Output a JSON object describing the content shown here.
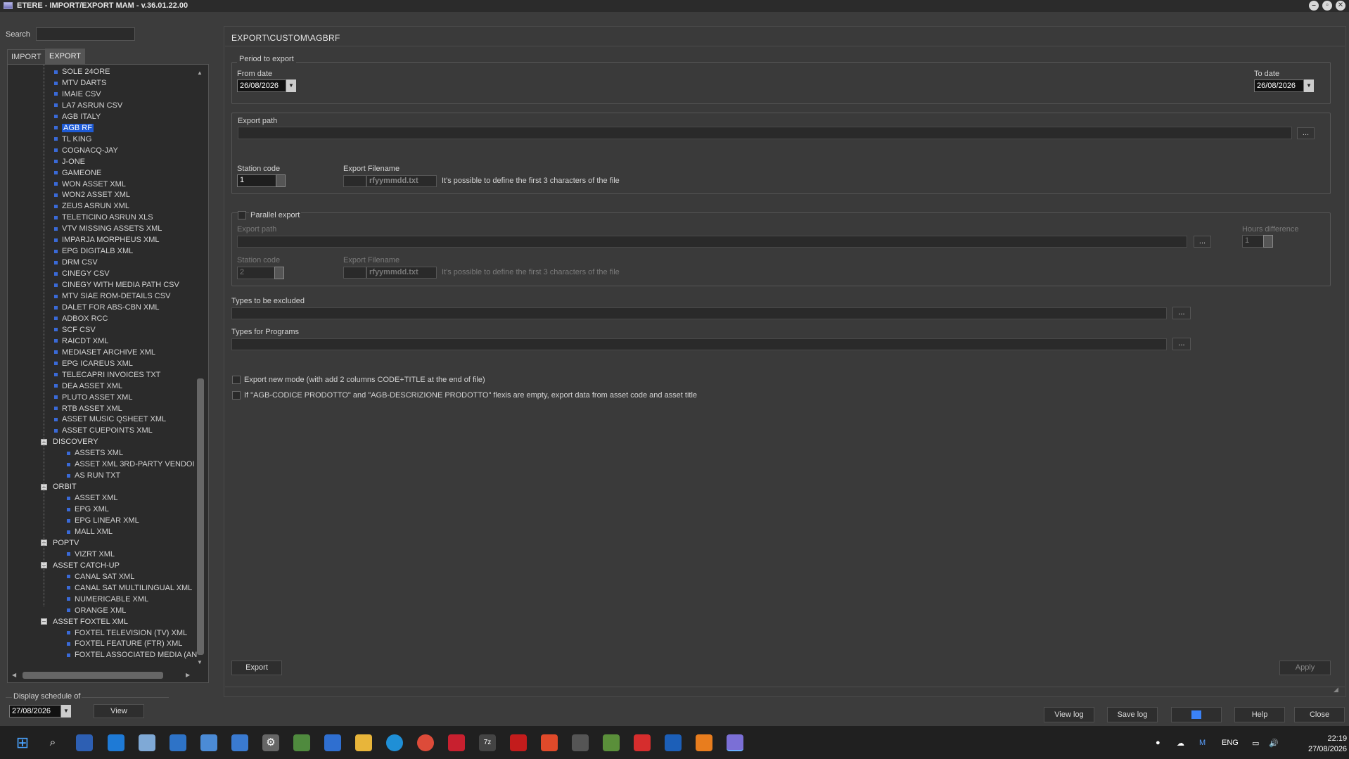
{
  "window": {
    "title": "ETERE - IMPORT/EXPORT MAM - v.36.01.22.00"
  },
  "left": {
    "search_label": "Search",
    "search_value": "",
    "tabs": [
      "IMPORT",
      "EXPORT"
    ],
    "tree_items": [
      {
        "label": "SOLE 24ORE",
        "indent": 1
      },
      {
        "label": "MTV DARTS",
        "indent": 1
      },
      {
        "label": "IMAIE CSV",
        "indent": 1
      },
      {
        "label": "LA7 ASRUN CSV",
        "indent": 1
      },
      {
        "label": "AGB ITALY",
        "indent": 1
      },
      {
        "label": "AGB RF",
        "indent": 1,
        "selected": true
      },
      {
        "label": "TL KING",
        "indent": 1
      },
      {
        "label": "COGNACQ-JAY",
        "indent": 1
      },
      {
        "label": "J-ONE",
        "indent": 1
      },
      {
        "label": "GAMEONE",
        "indent": 1
      },
      {
        "label": "WON ASSET XML",
        "indent": 1
      },
      {
        "label": "WON2 ASSET XML",
        "indent": 1
      },
      {
        "label": "ZEUS ASRUN XML",
        "indent": 1
      },
      {
        "label": "TELETICINO ASRUN XLS",
        "indent": 1
      },
      {
        "label": "VTV MISSING ASSETS XML",
        "indent": 1
      },
      {
        "label": "IMPARJA MORPHEUS XML",
        "indent": 1
      },
      {
        "label": "EPG DIGITALB XML",
        "indent": 1
      },
      {
        "label": "DRM CSV",
        "indent": 1
      },
      {
        "label": "CINEGY CSV",
        "indent": 1
      },
      {
        "label": "CINEGY WITH MEDIA PATH CSV",
        "indent": 1
      },
      {
        "label": "MTV SIAE ROM-DETAILS CSV",
        "indent": 1
      },
      {
        "label": "DALET FOR ABS-CBN XML",
        "indent": 1
      },
      {
        "label": "ADBOX RCC",
        "indent": 1
      },
      {
        "label": "SCF CSV",
        "indent": 1
      },
      {
        "label": "RAICDT XML",
        "indent": 1
      },
      {
        "label": "MEDIASET ARCHIVE XML",
        "indent": 1
      },
      {
        "label": "EPG ICAREUS XML",
        "indent": 1
      },
      {
        "label": "TELECAPRI INVOICES TXT",
        "indent": 1
      },
      {
        "label": "DEA ASSET XML",
        "indent": 1
      },
      {
        "label": "PLUTO ASSET XML",
        "indent": 1
      },
      {
        "label": "RTB ASSET XML",
        "indent": 1
      },
      {
        "label": "ASSET MUSIC QSHEET XML",
        "indent": 1
      },
      {
        "label": "ASSET CUEPOINTS XML",
        "indent": 1
      },
      {
        "label": "DISCOVERY",
        "group": true
      },
      {
        "label": "ASSETS XML",
        "indent": 2
      },
      {
        "label": "ASSET XML 3RD-PARTY VENDOI",
        "indent": 2
      },
      {
        "label": "AS RUN TXT",
        "indent": 2
      },
      {
        "label": "ORBIT",
        "group": true
      },
      {
        "label": "ASSET XML",
        "indent": 2
      },
      {
        "label": "EPG XML",
        "indent": 2
      },
      {
        "label": "EPG LINEAR XML",
        "indent": 2
      },
      {
        "label": "MALL XML",
        "indent": 2
      },
      {
        "label": "POPTV",
        "group": true
      },
      {
        "label": "VIZRT XML",
        "indent": 2
      },
      {
        "label": "ASSET CATCH-UP",
        "group": true
      },
      {
        "label": "CANAL SAT XML",
        "indent": 2
      },
      {
        "label": "CANAL SAT MULTILINGUAL XML",
        "indent": 2
      },
      {
        "label": "NUMERICABLE XML",
        "indent": 2
      },
      {
        "label": "ORANGE XML",
        "indent": 2
      },
      {
        "label": "ASSET FOXTEL XML",
        "group": true
      },
      {
        "label": "FOXTEL TELEVISION (TV) XML",
        "indent": 2
      },
      {
        "label": "FOXTEL FEATURE (FTR) XML",
        "indent": 2
      },
      {
        "label": "FOXTEL ASSOCIATED MEDIA (AN",
        "indent": 2
      }
    ],
    "display_schedule_label": "Display schedule of",
    "display_date": "27/08/2026",
    "view_button": "View"
  },
  "main": {
    "path_title": "EXPORT\\CUSTOM\\AGBRF",
    "period": {
      "group_label": "Period to export",
      "from_label": "From date",
      "from_value": "26/08/2026",
      "to_label": "To date",
      "to_value": "26/08/2026"
    },
    "export": {
      "path_label": "Export path",
      "path_value": "",
      "browse": "...",
      "station_label": "Station code",
      "station_value": "1",
      "filename_label": "Export Filename",
      "filename_value": "rfyymmdd.txt",
      "filename_hint": "It's possible to define the first 3 characters of the file"
    },
    "parallel": {
      "checkbox_label": "Parallel export",
      "path_label": "Export path",
      "browse": "...",
      "hours_label": "Hours difference",
      "hours_value": "1",
      "station_label": "Station code",
      "station_value": "2",
      "filename_label": "Export Filename",
      "filename_value": "rfyymmdd.txt",
      "filename_hint": "It's possible to define the first 3 characters of the file"
    },
    "types_excluded_label": "Types to be excluded",
    "types_programs_label": "Types for Programs",
    "browse": "...",
    "option1": "Export new mode (with add 2 columns CODE+TITLE at the end of file)",
    "option2": "If \"AGB-CODICE PRODOTTO\" and \"AGB-DESCRIZIONE PRODOTTO\" flexis are empty, export data from asset code and asset title",
    "export_button": "Export",
    "apply_button": "Apply"
  },
  "bottom": {
    "view_log": "View log",
    "save_log": "Save log",
    "help": "Help",
    "close": "Close"
  },
  "taskbar": {
    "language": "ENG",
    "time": "22:19",
    "date": "27/08/2026"
  }
}
